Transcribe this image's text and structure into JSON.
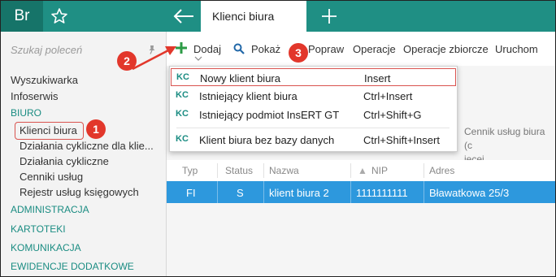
{
  "app": {
    "logo_text": "Br",
    "tab_title": "Klienci biura"
  },
  "sidebar": {
    "search_placeholder": "Szukaj poleceń",
    "items": [
      {
        "label": "Wyszukiwarka"
      },
      {
        "label": "Infoserwis"
      },
      {
        "label": "BIURO"
      },
      {
        "label": "Klienci biura"
      },
      {
        "label": "Działania cykliczne dla klie..."
      },
      {
        "label": "Działania cykliczne"
      },
      {
        "label": "Cenniki usług"
      },
      {
        "label": "Rejestr usług księgowych"
      },
      {
        "label": "ADMINISTRACJA"
      },
      {
        "label": "KARTOTEKI"
      },
      {
        "label": "KOMUNIKACJA"
      },
      {
        "label": "EWIDENCJE DODATKOWE"
      }
    ]
  },
  "toolbar": {
    "add_label": "Dodaj",
    "show_label": "Pokaż",
    "edit_label": "Popraw",
    "operations_label": "Operacje",
    "bulk_operations_label": "Operacje zbiorcze",
    "run_label": "Uruchom"
  },
  "dropdown": {
    "items": [
      {
        "badge": "KC",
        "label": "Nowy klient biura",
        "shortcut": "Insert"
      },
      {
        "badge": "KC",
        "label": "Istniejący klient biura",
        "shortcut": "Ctrl+Insert"
      },
      {
        "badge": "KC",
        "label": "Istniejący podmiot InsERT GT",
        "shortcut": "Ctrl+Shift+G"
      },
      {
        "badge": "KC",
        "label": "Klient biura bez bazy danych",
        "shortcut": "Ctrl+Shift+Insert"
      }
    ]
  },
  "filter_text": {
    "line1": "Cennik usług biura (c",
    "line2": "ięcej"
  },
  "table": {
    "columns": [
      "Typ",
      "Status",
      "Nazwa",
      "NIP",
      "Adres"
    ],
    "rows": [
      {
        "typ": "FI",
        "status": "S",
        "nazwa": "klient biura 2",
        "nip": "1111111111",
        "adres": "Bławatkowa 25/3"
      }
    ]
  },
  "callouts": {
    "one": "1",
    "two": "2",
    "three": "3"
  },
  "colors": {
    "brand": "#1f8f84",
    "accent": "#2d98dd",
    "callout": "#e2372b"
  }
}
